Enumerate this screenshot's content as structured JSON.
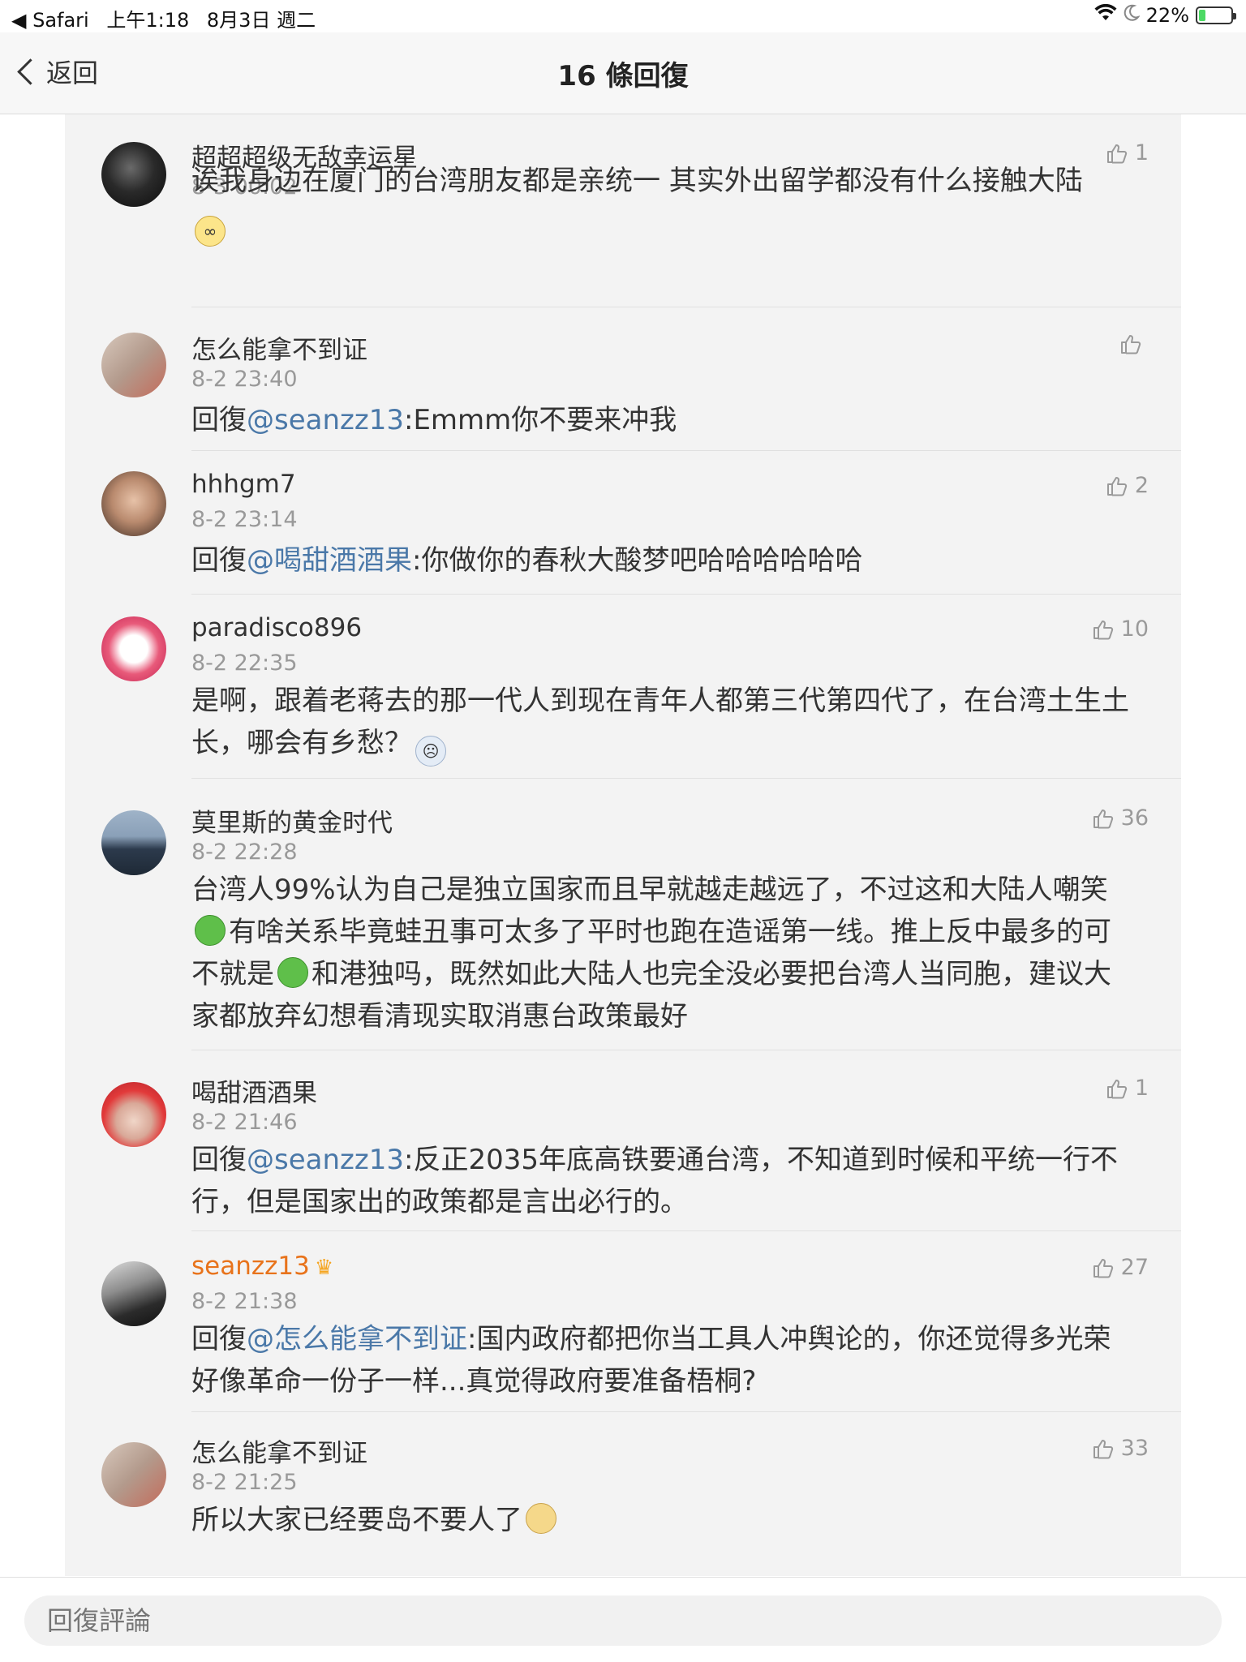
{
  "status_bar": {
    "back_app": "◀ Safari",
    "time": "上午1:18",
    "date": "8月3日 週二",
    "battery": "22%",
    "battery_fraction": 0.22
  },
  "nav": {
    "back_label": "返回",
    "title": "16 條回復"
  },
  "comments": [
    {
      "user": "超超超级无敌幸运星",
      "time": "8-3 00:02",
      "likes": "1",
      "text": "诶我身边在厦门的台湾朋友都是亲统一 其实外出留学都没有什么接触大陆"
    },
    {
      "user": "怎么能拿不到证",
      "time": "8-2 23:40",
      "likes": "",
      "reply_prefix": "回復",
      "mention": "@seanzz13",
      "text": ":Emmm你不要来冲我"
    },
    {
      "user": "hhhgm7",
      "time": "8-2 23:14",
      "likes": "2",
      "reply_prefix": "回復",
      "mention": "@喝甜酒酒果",
      "text": ":你做你的春秋大酸梦吧哈哈哈哈哈哈"
    },
    {
      "user": "paradisco896",
      "time": "8-2 22:35",
      "likes": "10",
      "text": "是啊，跟着老蒋去的那一代人到现在青年人都第三代第四代了，在台湾土生土长，哪会有乡愁？"
    },
    {
      "user": "莫里斯的黄金时代",
      "time": "8-2 22:28",
      "likes": "36",
      "text_parts": [
        "台湾人99%认为自己是独立国家而且早就越走越远了，不过这和大陆人嘲笑",
        "有啥关系毕竟蛙丑事可太多了平时也跑在造谣第一线。推上反中最多的可不就是",
        "和港独吗，既然如此大陆人也完全没必要把台湾人当同胞，建议大家都放弃幻想看清现实取消惠台政策最好"
      ]
    },
    {
      "user": "喝甜酒酒果",
      "time": "8-2 21:46",
      "likes": "1",
      "reply_prefix": "回復",
      "mention": "@seanzz13",
      "text": ":反正2035年底高铁要通台湾，不知道到时候和平统一行不行，但是国家出的政策都是言出必行的。"
    },
    {
      "user": "seanzz13",
      "time": "8-2 21:38",
      "likes": "27",
      "reply_prefix": "回復",
      "mention": "@怎么能拿不到证",
      "text": ":国内政府都把你当工具人冲舆论的，你还觉得多光荣好像革命一份子一样...真觉得政府要准备梧桐?"
    },
    {
      "user": "怎么能拿不到证",
      "time": "8-2 21:25",
      "likes": "33",
      "text": "所以大家已经要岛不要人了"
    }
  ],
  "reply_bar": {
    "placeholder": "回復評論"
  }
}
